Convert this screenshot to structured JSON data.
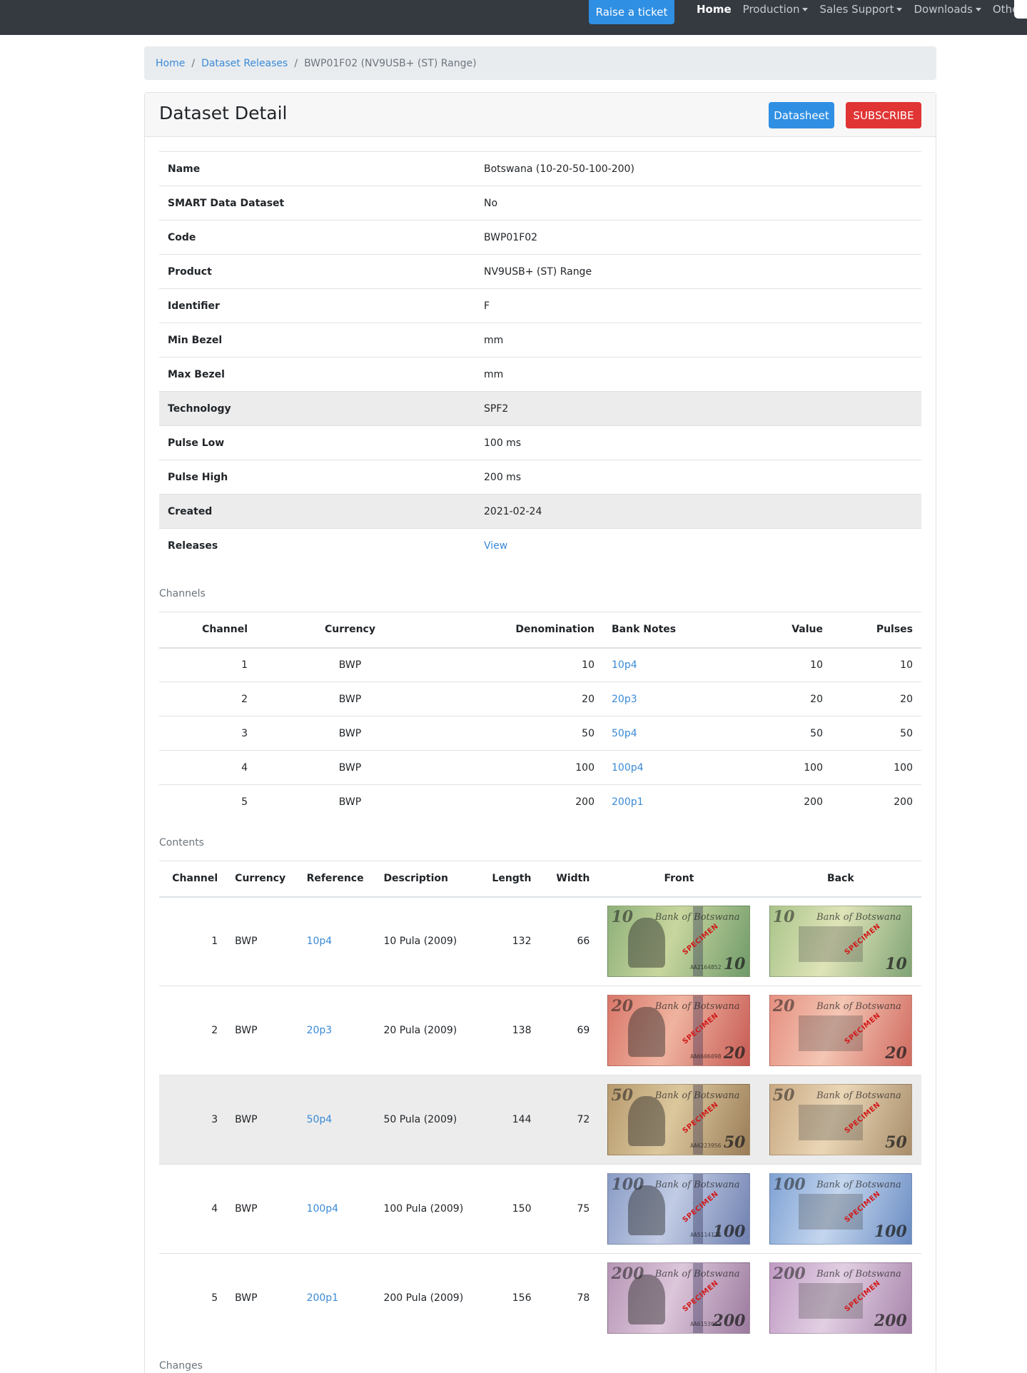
{
  "nav": {
    "ticket_label": "Raise a ticket",
    "items": [
      {
        "label": "Home",
        "dropdown": false
      },
      {
        "label": "Production",
        "dropdown": true
      },
      {
        "label": "Sales Support",
        "dropdown": true
      },
      {
        "label": "Downloads",
        "dropdown": true
      },
      {
        "label": "Other",
        "dropdown": true
      }
    ]
  },
  "breadcrumb": {
    "home": "Home",
    "releases": "Dataset Releases",
    "current": "BWP01F02 (NV9USB+ (ST) Range)"
  },
  "header": {
    "title": "Dataset Detail",
    "datasheet_label": "Datasheet",
    "subscribe_label": "SUBSCRIBE"
  },
  "details": [
    {
      "key": "Name",
      "value": "Botswana (10-20-50-100-200)"
    },
    {
      "key": "SMART Data Dataset",
      "value": "No"
    },
    {
      "key": "Code",
      "value": "BWP01F02"
    },
    {
      "key": "Product",
      "value": "NV9USB+ (ST) Range"
    },
    {
      "key": "Identifier",
      "value": "F"
    },
    {
      "key": "Min Bezel",
      "value": "mm"
    },
    {
      "key": "Max Bezel",
      "value": "mm"
    },
    {
      "key": "Technology",
      "value": "SPF2"
    },
    {
      "key": "Pulse Low",
      "value": "100 ms"
    },
    {
      "key": "Pulse High",
      "value": "200 ms"
    },
    {
      "key": "Created",
      "value": "2021-02-24"
    },
    {
      "key": "Releases",
      "value": "View"
    }
  ],
  "channels": {
    "label": "Channels",
    "headers": [
      "Channel",
      "Currency",
      "Denomination",
      "Bank Notes",
      "Value",
      "Pulses"
    ],
    "rows": [
      {
        "channel": "1",
        "currency": "BWP",
        "denomination": "10",
        "note": "10p4",
        "value": "10",
        "pulses": "10"
      },
      {
        "channel": "2",
        "currency": "BWP",
        "denomination": "20",
        "note": "20p3",
        "value": "20",
        "pulses": "20"
      },
      {
        "channel": "3",
        "currency": "BWP",
        "denomination": "50",
        "note": "50p4",
        "value": "50",
        "pulses": "50"
      },
      {
        "channel": "4",
        "currency": "BWP",
        "denomination": "100",
        "note": "100p4",
        "value": "100",
        "pulses": "100"
      },
      {
        "channel": "5",
        "currency": "BWP",
        "denomination": "200",
        "note": "200p1",
        "value": "200",
        "pulses": "200"
      }
    ]
  },
  "contents": {
    "label": "Contents",
    "headers": [
      "Channel",
      "Currency",
      "Reference",
      "Description",
      "Length",
      "Width",
      "Front",
      "Back"
    ],
    "rows": [
      {
        "channel": "1",
        "currency": "BWP",
        "reference": "10p4",
        "description": "10 Pula (2009)",
        "length": "132",
        "width": "66",
        "den": "10",
        "colors": [
          "#8fb07a",
          "#c8d69e",
          "#6f9a6a"
        ],
        "back_colors": [
          "#a9c48a",
          "#dfe4b8",
          "#7fa375"
        ]
      },
      {
        "channel": "2",
        "currency": "BWP",
        "reference": "20p3",
        "description": "20 Pula (2009)",
        "length": "138",
        "width": "69",
        "den": "20",
        "colors": [
          "#d9776a",
          "#efb39f",
          "#c75b54"
        ],
        "back_colors": [
          "#e58f80",
          "#f4c6b4",
          "#d06a5f"
        ]
      },
      {
        "channel": "3",
        "currency": "BWP",
        "reference": "50p4",
        "description": "50 Pula (2009)",
        "length": "144",
        "width": "72",
        "den": "50",
        "colors": [
          "#b79a6e",
          "#dcc79d",
          "#9a7d58"
        ],
        "back_colors": [
          "#c9a983",
          "#ead6b6",
          "#a88d6a"
        ]
      },
      {
        "channel": "4",
        "currency": "BWP",
        "reference": "100p4",
        "description": "100 Pula (2009)",
        "length": "150",
        "width": "75",
        "den": "100",
        "colors": [
          "#8a9cc6",
          "#c1cbe4",
          "#6f80b0"
        ],
        "back_colors": [
          "#7fa2d4",
          "#c4d6ee",
          "#6a8cc3"
        ]
      },
      {
        "channel": "5",
        "currency": "BWP",
        "reference": "200p1",
        "description": "200 Pula (2009)",
        "length": "156",
        "width": "78",
        "den": "200",
        "colors": [
          "#b796b6",
          "#dcc6da",
          "#9b7a9e"
        ],
        "back_colors": [
          "#c09bc4",
          "#e2cfe3",
          "#a784ab"
        ]
      }
    ]
  },
  "note_text": {
    "bank": "Bank of Botswana",
    "specimen": "SPECIMEN",
    "pula": "Pula",
    "serials": [
      "AA2164852",
      "AA6606098",
      "AA6223956",
      "AA5114174",
      "AA6153012"
    ]
  },
  "changes_label": "Changes",
  "colors": {
    "primary": "#2f8fe3",
    "danger": "#e13434",
    "navbar": "#343a40",
    "link": "#3a8ad6"
  }
}
